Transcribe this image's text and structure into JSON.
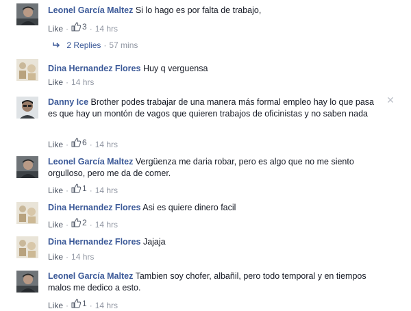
{
  "comments": [
    {
      "author": "Leonel García Maltez",
      "text": "Si lo hago es por falta de trabajo,",
      "like_label": "Like",
      "likes": "3",
      "time": "14 hrs",
      "avatar": "photo-man"
    },
    {
      "author": "Dina Hernandez Flores",
      "text": "Huy q verguensa",
      "like_label": "Like",
      "likes": "",
      "time": "14 hrs",
      "avatar": "photo-figures"
    },
    {
      "author": "Danny Ice",
      "text": "Brother podes trabajar de una manera más formal empleo hay lo que pasa es que hay un montón de vagos que quieren trabajos de oficinistas y no saben nada",
      "like_label": "Like",
      "likes": "6",
      "time": "14 hrs",
      "avatar": "photo-man-dark"
    },
    {
      "author": "Leonel García Maltez",
      "text": "Vergüenza me daria robar, pero es algo que no me siento orgulloso, pero me da de comer.",
      "like_label": "Like",
      "likes": "1",
      "time": "14 hrs",
      "avatar": "photo-man"
    },
    {
      "author": "Dina Hernandez Flores",
      "text": "Asi es quiere dinero facil",
      "like_label": "Like",
      "likes": "2",
      "time": "14 hrs",
      "avatar": "photo-figures"
    },
    {
      "author": "Dina Hernandez Flores",
      "text": "Jajaja",
      "like_label": "Like",
      "likes": "",
      "time": "14 hrs",
      "avatar": "photo-figures"
    },
    {
      "author": "Leonel García Maltez",
      "text": "Tambien soy chofer, albañil, pero todo temporal y en tiempos malos me dedico a esto.",
      "like_label": "Like",
      "likes": "1",
      "time": "14 hrs",
      "avatar": "photo-man"
    }
  ],
  "replies": {
    "label": "2 Replies",
    "time": "57 mins"
  },
  "close_icon": "close-icon",
  "colors": {
    "link": "#3b5998",
    "meta": "#9197a3",
    "text": "#141823"
  }
}
